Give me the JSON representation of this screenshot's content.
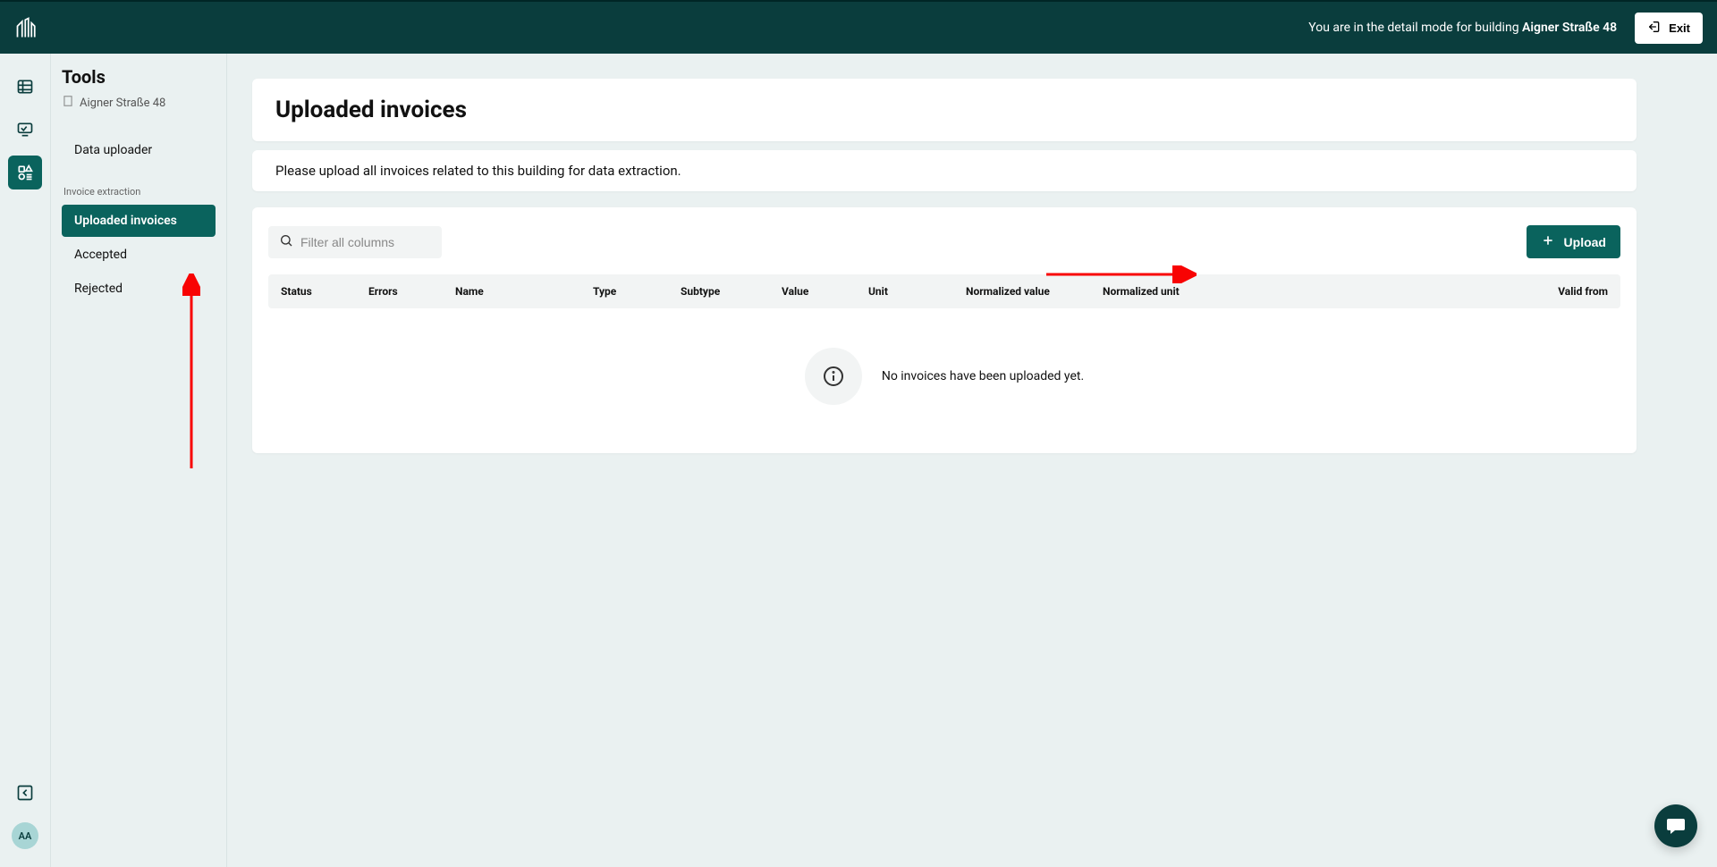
{
  "header": {
    "mode_text_prefix": "You are in the detail mode for building ",
    "mode_building": "Aigner Straße 48",
    "exit_label": "Exit"
  },
  "sidebar": {
    "title": "Tools",
    "building_name": "Aigner Straße 48",
    "items": {
      "data_uploader": "Data uploader"
    },
    "group_label": "Invoice extraction",
    "invoice_items": {
      "uploaded": "Uploaded invoices",
      "accepted": "Accepted",
      "rejected": "Rejected"
    }
  },
  "avatar": {
    "initials": "AA"
  },
  "main": {
    "page_title": "Uploaded invoices",
    "help_text": "Please upload all invoices related to this building for data extraction.",
    "search": {
      "placeholder": "Filter all columns"
    },
    "upload_label": "Upload",
    "table_columns": {
      "status": "Status",
      "errors": "Errors",
      "name": "Name",
      "type": "Type",
      "subtype": "Subtype",
      "value": "Value",
      "unit": "Unit",
      "normalized_value": "Normalized value",
      "normalized_unit": "Normalized unit",
      "valid_from": "Valid from"
    },
    "empty_message": "No invoices have been uploaded yet."
  }
}
